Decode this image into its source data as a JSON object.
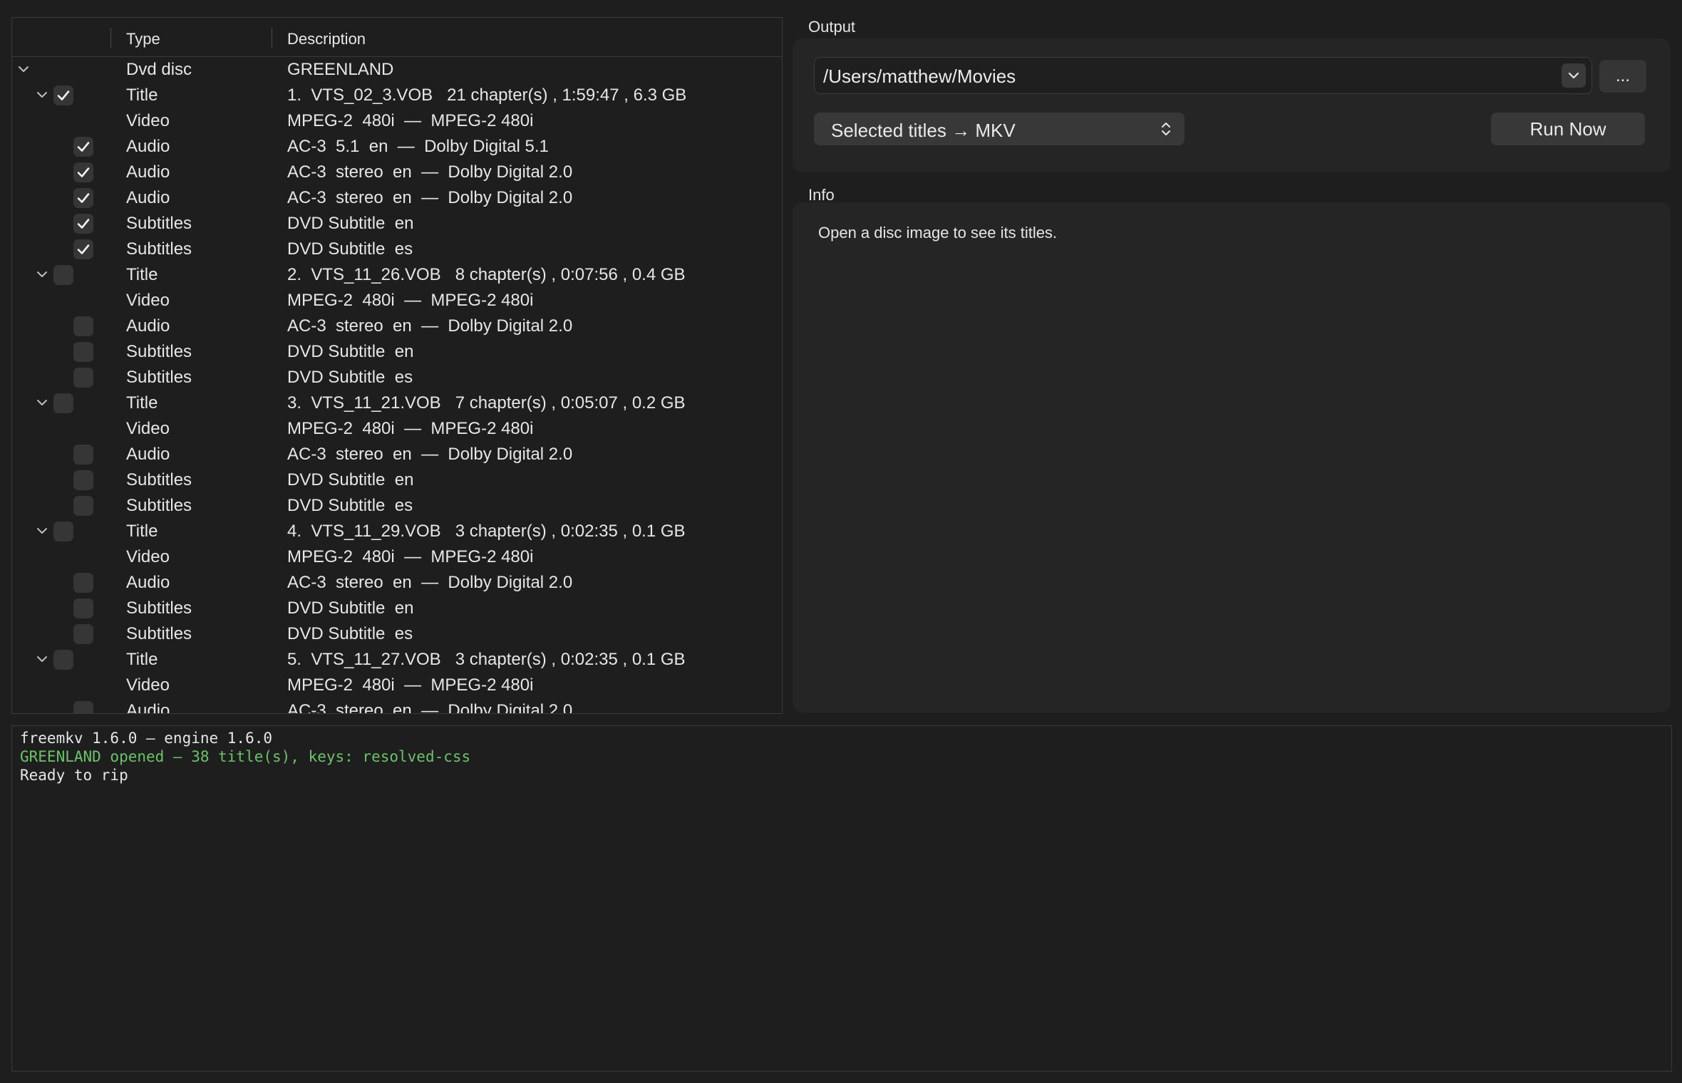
{
  "tree": {
    "columns": {
      "type": "Type",
      "description": "Description"
    },
    "rows": [
      {
        "level": 0,
        "expander": true,
        "checkbox": null,
        "type": "Dvd disc",
        "desc": "GREENLAND"
      },
      {
        "level": 1,
        "expander": true,
        "checkbox": true,
        "type": "Title",
        "desc": "1.  VTS_02_3.VOB   21 chapter(s) , 1:59:47 , 6.3 GB"
      },
      {
        "level": 2,
        "expander": false,
        "checkbox": null,
        "type": "Video",
        "desc": "MPEG-2  480i  —  MPEG-2 480i"
      },
      {
        "level": 2,
        "expander": false,
        "checkbox": true,
        "type": "Audio",
        "desc": "AC-3  5.1  en  —  Dolby Digital 5.1"
      },
      {
        "level": 2,
        "expander": false,
        "checkbox": true,
        "type": "Audio",
        "desc": "AC-3  stereo  en  —  Dolby Digital 2.0"
      },
      {
        "level": 2,
        "expander": false,
        "checkbox": true,
        "type": "Audio",
        "desc": "AC-3  stereo  en  —  Dolby Digital 2.0"
      },
      {
        "level": 2,
        "expander": false,
        "checkbox": true,
        "type": "Subtitles",
        "desc": "DVD Subtitle  en"
      },
      {
        "level": 2,
        "expander": false,
        "checkbox": true,
        "type": "Subtitles",
        "desc": "DVD Subtitle  es"
      },
      {
        "level": 1,
        "expander": true,
        "checkbox": false,
        "type": "Title",
        "desc": "2.  VTS_11_26.VOB   8 chapter(s) , 0:07:56 , 0.4 GB"
      },
      {
        "level": 2,
        "expander": false,
        "checkbox": null,
        "type": "Video",
        "desc": "MPEG-2  480i  —  MPEG-2 480i"
      },
      {
        "level": 2,
        "expander": false,
        "checkbox": false,
        "type": "Audio",
        "desc": "AC-3  stereo  en  —  Dolby Digital 2.0"
      },
      {
        "level": 2,
        "expander": false,
        "checkbox": false,
        "type": "Subtitles",
        "desc": "DVD Subtitle  en"
      },
      {
        "level": 2,
        "expander": false,
        "checkbox": false,
        "type": "Subtitles",
        "desc": "DVD Subtitle  es"
      },
      {
        "level": 1,
        "expander": true,
        "checkbox": false,
        "type": "Title",
        "desc": "3.  VTS_11_21.VOB   7 chapter(s) , 0:05:07 , 0.2 GB"
      },
      {
        "level": 2,
        "expander": false,
        "checkbox": null,
        "type": "Video",
        "desc": "MPEG-2  480i  —  MPEG-2 480i"
      },
      {
        "level": 2,
        "expander": false,
        "checkbox": false,
        "type": "Audio",
        "desc": "AC-3  stereo  en  —  Dolby Digital 2.0"
      },
      {
        "level": 2,
        "expander": false,
        "checkbox": false,
        "type": "Subtitles",
        "desc": "DVD Subtitle  en"
      },
      {
        "level": 2,
        "expander": false,
        "checkbox": false,
        "type": "Subtitles",
        "desc": "DVD Subtitle  es"
      },
      {
        "level": 1,
        "expander": true,
        "checkbox": false,
        "type": "Title",
        "desc": "4.  VTS_11_29.VOB   3 chapter(s) , 0:02:35 , 0.1 GB"
      },
      {
        "level": 2,
        "expander": false,
        "checkbox": null,
        "type": "Video",
        "desc": "MPEG-2  480i  —  MPEG-2 480i"
      },
      {
        "level": 2,
        "expander": false,
        "checkbox": false,
        "type": "Audio",
        "desc": "AC-3  stereo  en  —  Dolby Digital 2.0"
      },
      {
        "level": 2,
        "expander": false,
        "checkbox": false,
        "type": "Subtitles",
        "desc": "DVD Subtitle  en"
      },
      {
        "level": 2,
        "expander": false,
        "checkbox": false,
        "type": "Subtitles",
        "desc": "DVD Subtitle  es"
      },
      {
        "level": 1,
        "expander": true,
        "checkbox": false,
        "type": "Title",
        "desc": "5.  VTS_11_27.VOB   3 chapter(s) , 0:02:35 , 0.1 GB"
      },
      {
        "level": 2,
        "expander": false,
        "checkbox": null,
        "type": "Video",
        "desc": "MPEG-2  480i  —  MPEG-2 480i"
      },
      {
        "level": 2,
        "expander": false,
        "checkbox": false,
        "type": "Audio",
        "desc": "AC-3  stereo  en  —  Dolby Digital 2.0"
      }
    ]
  },
  "output": {
    "label": "Output",
    "path": "/Users/matthew/Movies",
    "browse_label": "...",
    "mode": "Selected titles → MKV",
    "run_label": "Run Now"
  },
  "info": {
    "label": "Info",
    "text": "Open a disc image to see its titles."
  },
  "log": {
    "lines": [
      {
        "text": "freemkv 1.6.0 — engine 1.6.0",
        "color": "#e6e6e6"
      },
      {
        "text": "GREENLAND opened — 38 title(s), keys: resolved-css",
        "color": "#6cc26a"
      },
      {
        "text": "Ready to rip",
        "color": "#e6e6e6"
      }
    ]
  },
  "colors": {
    "accent_green": "#6cc26a",
    "panel_bg": "#252525",
    "window_bg": "#1e1e1e"
  }
}
